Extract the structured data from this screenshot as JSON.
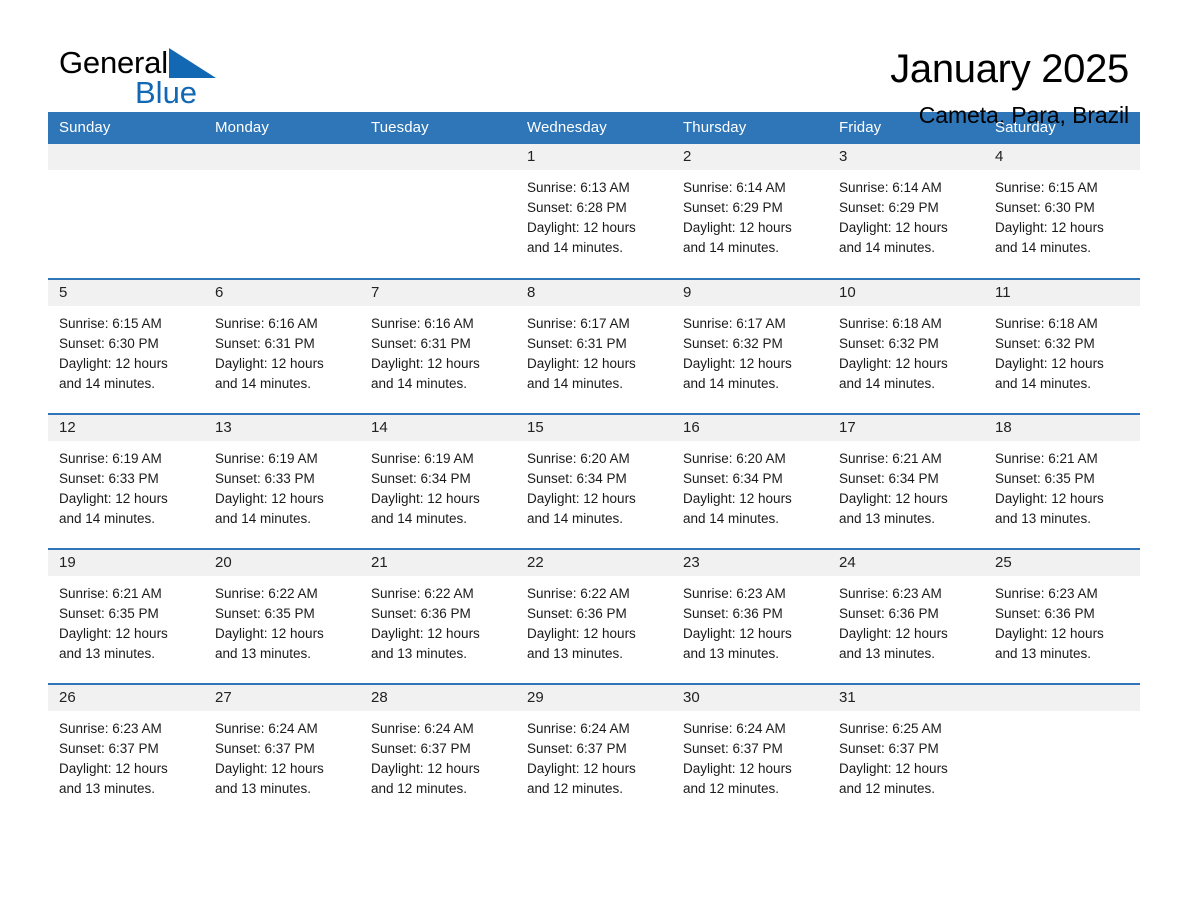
{
  "logo": {
    "word_dark": "General",
    "word_blue": "Blue",
    "triangle_color": "#1268b3"
  },
  "header": {
    "title": "January 2025",
    "subtitle": "Cameta, Para, Brazil"
  },
  "theme": {
    "header_blue": "#2e76b8",
    "daynum_band": "#f1f1f1",
    "text": "#1a1a1a"
  },
  "weekday_headers": [
    "Sunday",
    "Monday",
    "Tuesday",
    "Wednesday",
    "Thursday",
    "Friday",
    "Saturday"
  ],
  "labels": {
    "sunrise_prefix": "Sunrise:",
    "sunset_prefix": "Sunset:",
    "daylight_prefix": "Daylight:"
  },
  "weeks": [
    [
      {
        "day": "",
        "blank": true,
        "sunrise": "",
        "sunset": "",
        "daylight_line1": "",
        "daylight_line2": ""
      },
      {
        "day": "",
        "blank": true,
        "sunrise": "",
        "sunset": "",
        "daylight_line1": "",
        "daylight_line2": ""
      },
      {
        "day": "",
        "blank": true,
        "sunrise": "",
        "sunset": "",
        "daylight_line1": "",
        "daylight_line2": ""
      },
      {
        "day": "1",
        "sunrise": "Sunrise: 6:13 AM",
        "sunset": "Sunset: 6:28 PM",
        "daylight_line1": "Daylight: 12 hours",
        "daylight_line2": "and 14 minutes."
      },
      {
        "day": "2",
        "sunrise": "Sunrise: 6:14 AM",
        "sunset": "Sunset: 6:29 PM",
        "daylight_line1": "Daylight: 12 hours",
        "daylight_line2": "and 14 minutes."
      },
      {
        "day": "3",
        "sunrise": "Sunrise: 6:14 AM",
        "sunset": "Sunset: 6:29 PM",
        "daylight_line1": "Daylight: 12 hours",
        "daylight_line2": "and 14 minutes."
      },
      {
        "day": "4",
        "sunrise": "Sunrise: 6:15 AM",
        "sunset": "Sunset: 6:30 PM",
        "daylight_line1": "Daylight: 12 hours",
        "daylight_line2": "and 14 minutes."
      }
    ],
    [
      {
        "day": "5",
        "sunrise": "Sunrise: 6:15 AM",
        "sunset": "Sunset: 6:30 PM",
        "daylight_line1": "Daylight: 12 hours",
        "daylight_line2": "and 14 minutes."
      },
      {
        "day": "6",
        "sunrise": "Sunrise: 6:16 AM",
        "sunset": "Sunset: 6:31 PM",
        "daylight_line1": "Daylight: 12 hours",
        "daylight_line2": "and 14 minutes."
      },
      {
        "day": "7",
        "sunrise": "Sunrise: 6:16 AM",
        "sunset": "Sunset: 6:31 PM",
        "daylight_line1": "Daylight: 12 hours",
        "daylight_line2": "and 14 minutes."
      },
      {
        "day": "8",
        "sunrise": "Sunrise: 6:17 AM",
        "sunset": "Sunset: 6:31 PM",
        "daylight_line1": "Daylight: 12 hours",
        "daylight_line2": "and 14 minutes."
      },
      {
        "day": "9",
        "sunrise": "Sunrise: 6:17 AM",
        "sunset": "Sunset: 6:32 PM",
        "daylight_line1": "Daylight: 12 hours",
        "daylight_line2": "and 14 minutes."
      },
      {
        "day": "10",
        "sunrise": "Sunrise: 6:18 AM",
        "sunset": "Sunset: 6:32 PM",
        "daylight_line1": "Daylight: 12 hours",
        "daylight_line2": "and 14 minutes."
      },
      {
        "day": "11",
        "sunrise": "Sunrise: 6:18 AM",
        "sunset": "Sunset: 6:32 PM",
        "daylight_line1": "Daylight: 12 hours",
        "daylight_line2": "and 14 minutes."
      }
    ],
    [
      {
        "day": "12",
        "sunrise": "Sunrise: 6:19 AM",
        "sunset": "Sunset: 6:33 PM",
        "daylight_line1": "Daylight: 12 hours",
        "daylight_line2": "and 14 minutes."
      },
      {
        "day": "13",
        "sunrise": "Sunrise: 6:19 AM",
        "sunset": "Sunset: 6:33 PM",
        "daylight_line1": "Daylight: 12 hours",
        "daylight_line2": "and 14 minutes."
      },
      {
        "day": "14",
        "sunrise": "Sunrise: 6:19 AM",
        "sunset": "Sunset: 6:34 PM",
        "daylight_line1": "Daylight: 12 hours",
        "daylight_line2": "and 14 minutes."
      },
      {
        "day": "15",
        "sunrise": "Sunrise: 6:20 AM",
        "sunset": "Sunset: 6:34 PM",
        "daylight_line1": "Daylight: 12 hours",
        "daylight_line2": "and 14 minutes."
      },
      {
        "day": "16",
        "sunrise": "Sunrise: 6:20 AM",
        "sunset": "Sunset: 6:34 PM",
        "daylight_line1": "Daylight: 12 hours",
        "daylight_line2": "and 14 minutes."
      },
      {
        "day": "17",
        "sunrise": "Sunrise: 6:21 AM",
        "sunset": "Sunset: 6:34 PM",
        "daylight_line1": "Daylight: 12 hours",
        "daylight_line2": "and 13 minutes."
      },
      {
        "day": "18",
        "sunrise": "Sunrise: 6:21 AM",
        "sunset": "Sunset: 6:35 PM",
        "daylight_line1": "Daylight: 12 hours",
        "daylight_line2": "and 13 minutes."
      }
    ],
    [
      {
        "day": "19",
        "sunrise": "Sunrise: 6:21 AM",
        "sunset": "Sunset: 6:35 PM",
        "daylight_line1": "Daylight: 12 hours",
        "daylight_line2": "and 13 minutes."
      },
      {
        "day": "20",
        "sunrise": "Sunrise: 6:22 AM",
        "sunset": "Sunset: 6:35 PM",
        "daylight_line1": "Daylight: 12 hours",
        "daylight_line2": "and 13 minutes."
      },
      {
        "day": "21",
        "sunrise": "Sunrise: 6:22 AM",
        "sunset": "Sunset: 6:36 PM",
        "daylight_line1": "Daylight: 12 hours",
        "daylight_line2": "and 13 minutes."
      },
      {
        "day": "22",
        "sunrise": "Sunrise: 6:22 AM",
        "sunset": "Sunset: 6:36 PM",
        "daylight_line1": "Daylight: 12 hours",
        "daylight_line2": "and 13 minutes."
      },
      {
        "day": "23",
        "sunrise": "Sunrise: 6:23 AM",
        "sunset": "Sunset: 6:36 PM",
        "daylight_line1": "Daylight: 12 hours",
        "daylight_line2": "and 13 minutes."
      },
      {
        "day": "24",
        "sunrise": "Sunrise: 6:23 AM",
        "sunset": "Sunset: 6:36 PM",
        "daylight_line1": "Daylight: 12 hours",
        "daylight_line2": "and 13 minutes."
      },
      {
        "day": "25",
        "sunrise": "Sunrise: 6:23 AM",
        "sunset": "Sunset: 6:36 PM",
        "daylight_line1": "Daylight: 12 hours",
        "daylight_line2": "and 13 minutes."
      }
    ],
    [
      {
        "day": "26",
        "sunrise": "Sunrise: 6:23 AM",
        "sunset": "Sunset: 6:37 PM",
        "daylight_line1": "Daylight: 12 hours",
        "daylight_line2": "and 13 minutes."
      },
      {
        "day": "27",
        "sunrise": "Sunrise: 6:24 AM",
        "sunset": "Sunset: 6:37 PM",
        "daylight_line1": "Daylight: 12 hours",
        "daylight_line2": "and 13 minutes."
      },
      {
        "day": "28",
        "sunrise": "Sunrise: 6:24 AM",
        "sunset": "Sunset: 6:37 PM",
        "daylight_line1": "Daylight: 12 hours",
        "daylight_line2": "and 12 minutes."
      },
      {
        "day": "29",
        "sunrise": "Sunrise: 6:24 AM",
        "sunset": "Sunset: 6:37 PM",
        "daylight_line1": "Daylight: 12 hours",
        "daylight_line2": "and 12 minutes."
      },
      {
        "day": "30",
        "sunrise": "Sunrise: 6:24 AM",
        "sunset": "Sunset: 6:37 PM",
        "daylight_line1": "Daylight: 12 hours",
        "daylight_line2": "and 12 minutes."
      },
      {
        "day": "31",
        "sunrise": "Sunrise: 6:25 AM",
        "sunset": "Sunset: 6:37 PM",
        "daylight_line1": "Daylight: 12 hours",
        "daylight_line2": "and 12 minutes."
      },
      {
        "day": "",
        "blank": true,
        "sunrise": "",
        "sunset": "",
        "daylight_line1": "",
        "daylight_line2": ""
      }
    ]
  ]
}
